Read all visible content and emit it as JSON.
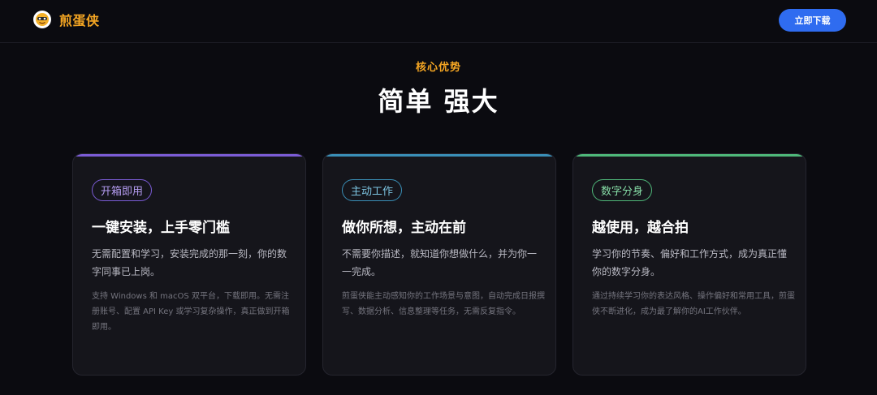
{
  "nav": {
    "brand_name": "煎蛋侠",
    "download_label": "立即下载",
    "brand_color": "#f5a623",
    "button_color": "#2f6cf0"
  },
  "section": {
    "eyebrow": "核心优势",
    "title": "简单 强大"
  },
  "cards": [
    {
      "tag": "开箱即用",
      "title": "一键安装，上手零门槛",
      "body": "无需配置和学习，安装完成的那一刻，你的数字同事已上岗。",
      "note": "支持 Windows 和 macOS 双平台，下载即用。无需注册账号、配置 API Key 或学习复杂操作，真正做到开箱即用。",
      "accent": "#7b5cd6"
    },
    {
      "tag": "主动工作",
      "title": "做你所想，主动在前",
      "body": "不需要你描述，就知道你想做什么，并为你一一完成。",
      "note": "煎蛋侠能主动感知你的工作场景与意图，自动完成日报撰写、数据分析、信息整理等任务，无需反复指令。",
      "accent": "#3a8fb7"
    },
    {
      "tag": "数字分身",
      "title": "越使用，越合拍",
      "body": "学习你的节奏、偏好和工作方式，成为真正懂你的数字分身。",
      "note": "通过持续学习你的表达风格、操作偏好和常用工具，煎蛋侠不断进化，成为最了解你的AI工作伙伴。",
      "accent": "#4fb87a"
    }
  ]
}
